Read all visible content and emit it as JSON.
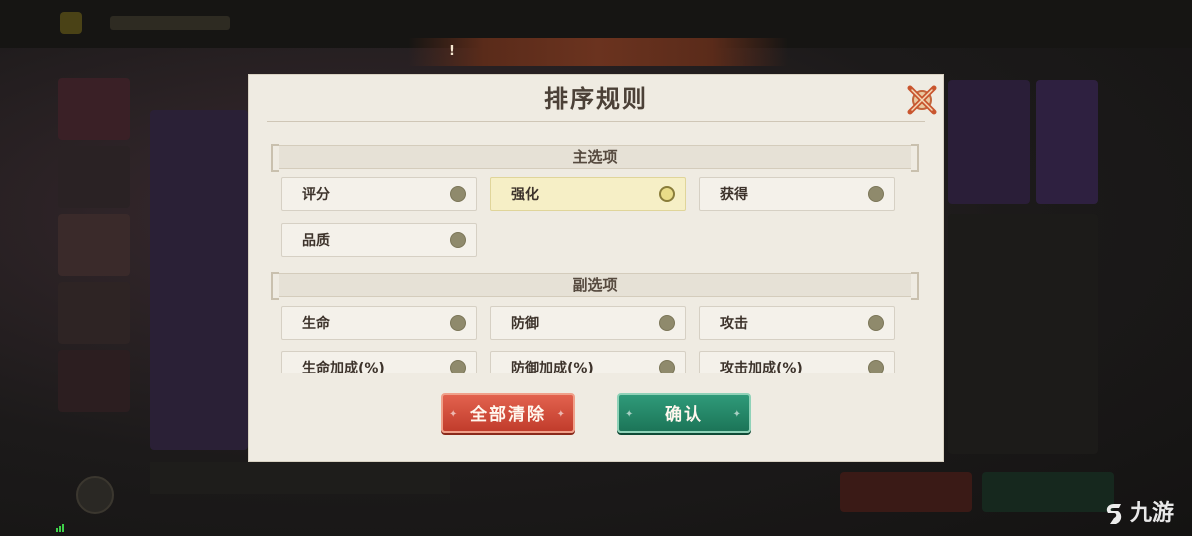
{
  "background": {
    "banner_text": "!"
  },
  "dialog": {
    "title": "排序规则",
    "close_icon": "close-x-icon",
    "primary_section": {
      "title": "主选项",
      "options": [
        {
          "label": "评分",
          "selected": false
        },
        {
          "label": "强化",
          "selected": true
        },
        {
          "label": "获得",
          "selected": false
        },
        {
          "label": "品质",
          "selected": false
        }
      ]
    },
    "secondary_section": {
      "title": "副选项",
      "options": [
        {
          "label": "生命",
          "selected": false
        },
        {
          "label": "防御",
          "selected": false
        },
        {
          "label": "攻击",
          "selected": false
        },
        {
          "label": "生命加成(%)",
          "selected": false
        },
        {
          "label": "防御加成(%)",
          "selected": false
        },
        {
          "label": "攻击加成(%)",
          "selected": false
        }
      ]
    },
    "clear_all_label": "全部清除",
    "confirm_label": "确认"
  },
  "watermark": {
    "text": "九游"
  },
  "colors": {
    "clear_button": "#c94433",
    "confirm_button": "#238564",
    "selected_option": "#f6efc6",
    "dialog_bg": "#efebe2"
  }
}
